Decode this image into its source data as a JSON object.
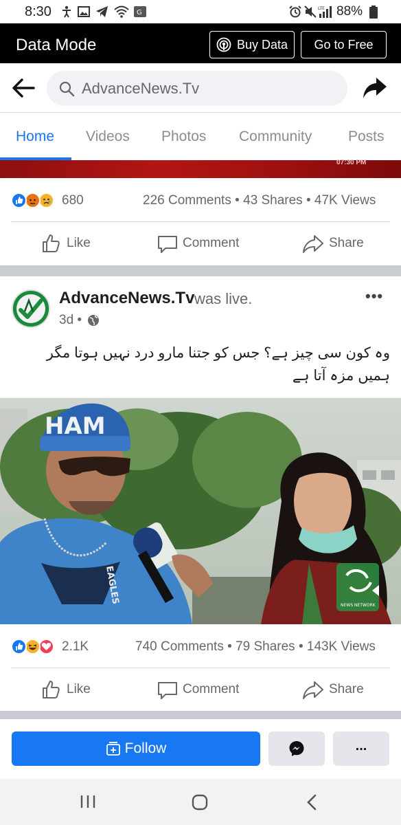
{
  "status_bar": {
    "time": "8:30",
    "battery": "88%",
    "network": "LTE"
  },
  "data_bar": {
    "title": "Data Mode",
    "buy_data": "Buy Data",
    "go_free": "Go to Free"
  },
  "search": {
    "value": "AdvanceNews.Tv"
  },
  "tabs": [
    {
      "label": "Home",
      "active": true
    },
    {
      "label": "Videos"
    },
    {
      "label": "Photos"
    },
    {
      "label": "Community"
    },
    {
      "label": "Posts"
    }
  ],
  "post1": {
    "reaction_count": "680",
    "comments": "226 Comments",
    "shares": "43 Shares",
    "views": "47K Views",
    "red_strip_time": "07:30 PM"
  },
  "post2": {
    "page_name": "AdvanceNews.Tv",
    "suffix": "was live.",
    "age": "3d",
    "text": "وہ کون سی چیز ہے؟ جس کو جتنا مارو درد نہیں ہوتا مگر ہمیں مزہ آتا ہے",
    "cap_text": "HAM",
    "shirt_text": "EAGLES",
    "watermark": "NEWS NETWORK",
    "reaction_count": "2.1K",
    "comments": "740 Comments",
    "shares": "79 Shares",
    "views": "143K Views"
  },
  "actions": {
    "like": "Like",
    "comment": "Comment",
    "share": "Share"
  },
  "bottom": {
    "follow": "Follow",
    "more": "..."
  },
  "colors": {
    "accent": "#1877f2",
    "reaction_like": "#1877f2",
    "reaction_angry": "#e9710f",
    "reaction_sad": "#f7b125",
    "reaction_love": "#f33e58"
  }
}
